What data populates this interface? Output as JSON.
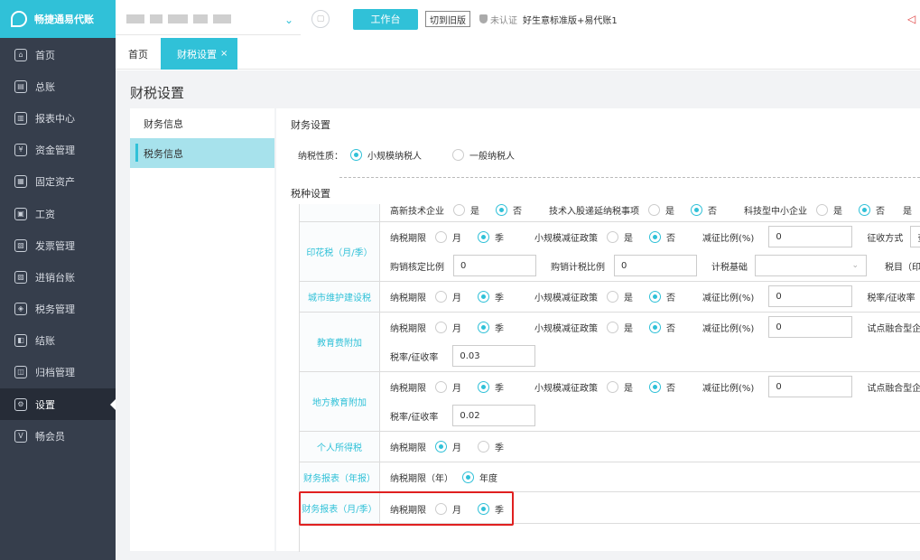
{
  "brand": {
    "name": "畅捷通易代账"
  },
  "sidebar": {
    "items": [
      {
        "label": "首页",
        "icon": "home-icon",
        "glyph": "⌂"
      },
      {
        "label": "总账",
        "icon": "ledger-icon",
        "glyph": "▤"
      },
      {
        "label": "报表中心",
        "icon": "chart-icon",
        "glyph": "▥"
      },
      {
        "label": "资金管理",
        "icon": "money-icon",
        "glyph": "¥"
      },
      {
        "label": "固定资产",
        "icon": "asset-icon",
        "glyph": "▦"
      },
      {
        "label": "工资",
        "icon": "salary-icon",
        "glyph": "▣"
      },
      {
        "label": "发票管理",
        "icon": "invoice-icon",
        "glyph": "▧"
      },
      {
        "label": "进销台账",
        "icon": "inventory-icon",
        "glyph": "▨"
      },
      {
        "label": "税务管理",
        "icon": "tax-icon",
        "glyph": "◈"
      },
      {
        "label": "结账",
        "icon": "close-account-icon",
        "glyph": "◧"
      },
      {
        "label": "归档管理",
        "icon": "archive-icon",
        "glyph": "◫"
      },
      {
        "label": "设置",
        "icon": "settings-icon",
        "glyph": "⚙"
      },
      {
        "label": "畅会员",
        "icon": "vip-icon",
        "glyph": "V"
      }
    ],
    "active_index": 11
  },
  "topbar": {
    "workbench_label": "工作台",
    "switch_old_label": "切到旧版",
    "cert_label": "未认证",
    "account_name": "好生意标准版+易代账1"
  },
  "tabs": {
    "home": "首页",
    "active": "财税设置",
    "close": "×"
  },
  "page_title": "财税设置",
  "left_menu": [
    "财务信息",
    "税务信息"
  ],
  "finance": {
    "section_title": "财务设置",
    "taxpayer_label": "纳税性质：",
    "taxpayer_options": [
      "小规模纳税人",
      "一般纳税人"
    ],
    "taxpayer_selected": 0,
    "tax_setting_label": "税种设置"
  },
  "tax_rows": {
    "top_partial": {
      "f1": "高新技术企业",
      "f1_yes": "是",
      "f1_no": "否",
      "f2": "技术入股递延纳税事项",
      "f2_yes": "是",
      "f2_no": "否",
      "f3": "科技型中小企业",
      "f3_yes": "是",
      "f3_no": "否",
      "f4": "是"
    },
    "stamp": {
      "name": "印花税（月/季）",
      "period_label": "纳税期限",
      "month": "月",
      "quarter": "季",
      "policy_label": "小规模减征政策",
      "yes": "是",
      "no": "否",
      "ratio_label": "减征比例(%)",
      "ratio_value": "0",
      "method_label": "征收方式",
      "method_value": "查",
      "purchase_label": "购销核定比例",
      "purchase_value": "0",
      "purchase_tax_label": "购销计税比例",
      "purchase_tax_value": "0",
      "base_label": "计税基础",
      "item_label": "税目（印"
    },
    "urban": {
      "name": "城市维护建设税",
      "period_label": "纳税期限",
      "month": "月",
      "quarter": "季",
      "policy_label": "小规模减征政策",
      "yes": "是",
      "no": "否",
      "ratio_label": "减征比例(%)",
      "ratio_value": "0",
      "rate_label": "税率/征收率"
    },
    "edu": {
      "name": "教育费附加",
      "period_label": "纳税期限",
      "month": "月",
      "quarter": "季",
      "policy_label": "小规模减征政策",
      "yes": "是",
      "no": "否",
      "ratio_label": "减征比例(%)",
      "ratio_value": "0",
      "pilot_label": "试点融合型企业",
      "rate_label": "税率/征收率",
      "rate_value": "0.03"
    },
    "local_edu": {
      "name": "地方教育附加",
      "period_label": "纳税期限",
      "month": "月",
      "quarter": "季",
      "policy_label": "小规模减征政策",
      "yes": "是",
      "no": "否",
      "ratio_label": "减征比例(%)",
      "ratio_value": "0",
      "pilot_label": "试点融合型企业",
      "rate_label": "税率/征收率",
      "rate_value": "0.02"
    },
    "personal": {
      "name": "个人所得税",
      "period_label": "纳税期限",
      "month": "月",
      "quarter": "季"
    },
    "report_year": {
      "name": "财务报表（年报）",
      "period_label": "纳税期限（年）",
      "year": "年度"
    },
    "report_month": {
      "name": "财务报表（月/季）",
      "period_label": "纳税期限",
      "month": "月",
      "quarter": "季"
    }
  },
  "colors": {
    "accent": "#30c1d8",
    "sidebar": "#363e4c",
    "highlight": "#e02020"
  }
}
